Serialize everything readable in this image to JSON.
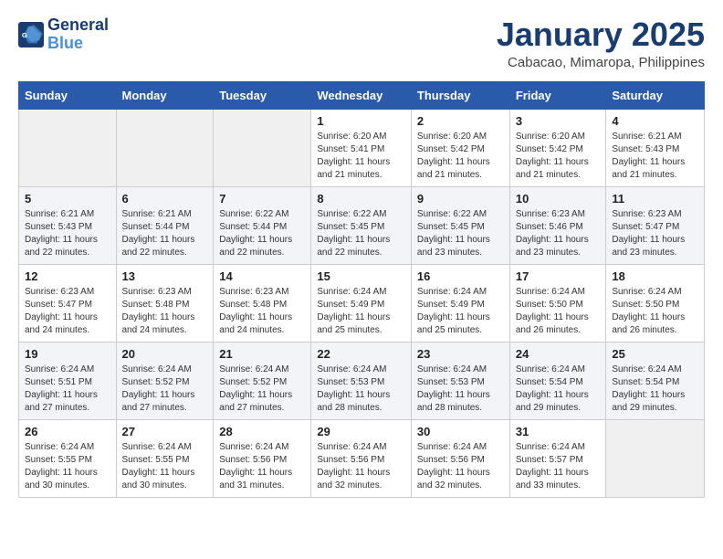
{
  "logo": {
    "text_general": "General",
    "text_blue": "Blue"
  },
  "calendar": {
    "title": "January 2025",
    "subtitle": "Cabacao, Mimaropa, Philippines"
  },
  "weekdays": [
    "Sunday",
    "Monday",
    "Tuesday",
    "Wednesday",
    "Thursday",
    "Friday",
    "Saturday"
  ],
  "weeks": [
    [
      {
        "day": "",
        "empty": true
      },
      {
        "day": "",
        "empty": true
      },
      {
        "day": "",
        "empty": true
      },
      {
        "day": "1",
        "sunrise": "6:20 AM",
        "sunset": "5:41 PM",
        "daylight": "11 hours and 21 minutes."
      },
      {
        "day": "2",
        "sunrise": "6:20 AM",
        "sunset": "5:42 PM",
        "daylight": "11 hours and 21 minutes."
      },
      {
        "day": "3",
        "sunrise": "6:20 AM",
        "sunset": "5:42 PM",
        "daylight": "11 hours and 21 minutes."
      },
      {
        "day": "4",
        "sunrise": "6:21 AM",
        "sunset": "5:43 PM",
        "daylight": "11 hours and 21 minutes."
      }
    ],
    [
      {
        "day": "5",
        "sunrise": "6:21 AM",
        "sunset": "5:43 PM",
        "daylight": "11 hours and 22 minutes."
      },
      {
        "day": "6",
        "sunrise": "6:21 AM",
        "sunset": "5:44 PM",
        "daylight": "11 hours and 22 minutes."
      },
      {
        "day": "7",
        "sunrise": "6:22 AM",
        "sunset": "5:44 PM",
        "daylight": "11 hours and 22 minutes."
      },
      {
        "day": "8",
        "sunrise": "6:22 AM",
        "sunset": "5:45 PM",
        "daylight": "11 hours and 22 minutes."
      },
      {
        "day": "9",
        "sunrise": "6:22 AM",
        "sunset": "5:45 PM",
        "daylight": "11 hours and 23 minutes."
      },
      {
        "day": "10",
        "sunrise": "6:23 AM",
        "sunset": "5:46 PM",
        "daylight": "11 hours and 23 minutes."
      },
      {
        "day": "11",
        "sunrise": "6:23 AM",
        "sunset": "5:47 PM",
        "daylight": "11 hours and 23 minutes."
      }
    ],
    [
      {
        "day": "12",
        "sunrise": "6:23 AM",
        "sunset": "5:47 PM",
        "daylight": "11 hours and 24 minutes."
      },
      {
        "day": "13",
        "sunrise": "6:23 AM",
        "sunset": "5:48 PM",
        "daylight": "11 hours and 24 minutes."
      },
      {
        "day": "14",
        "sunrise": "6:23 AM",
        "sunset": "5:48 PM",
        "daylight": "11 hours and 24 minutes."
      },
      {
        "day": "15",
        "sunrise": "6:24 AM",
        "sunset": "5:49 PM",
        "daylight": "11 hours and 25 minutes."
      },
      {
        "day": "16",
        "sunrise": "6:24 AM",
        "sunset": "5:49 PM",
        "daylight": "11 hours and 25 minutes."
      },
      {
        "day": "17",
        "sunrise": "6:24 AM",
        "sunset": "5:50 PM",
        "daylight": "11 hours and 26 minutes."
      },
      {
        "day": "18",
        "sunrise": "6:24 AM",
        "sunset": "5:50 PM",
        "daylight": "11 hours and 26 minutes."
      }
    ],
    [
      {
        "day": "19",
        "sunrise": "6:24 AM",
        "sunset": "5:51 PM",
        "daylight": "11 hours and 27 minutes."
      },
      {
        "day": "20",
        "sunrise": "6:24 AM",
        "sunset": "5:52 PM",
        "daylight": "11 hours and 27 minutes."
      },
      {
        "day": "21",
        "sunrise": "6:24 AM",
        "sunset": "5:52 PM",
        "daylight": "11 hours and 27 minutes."
      },
      {
        "day": "22",
        "sunrise": "6:24 AM",
        "sunset": "5:53 PM",
        "daylight": "11 hours and 28 minutes."
      },
      {
        "day": "23",
        "sunrise": "6:24 AM",
        "sunset": "5:53 PM",
        "daylight": "11 hours and 28 minutes."
      },
      {
        "day": "24",
        "sunrise": "6:24 AM",
        "sunset": "5:54 PM",
        "daylight": "11 hours and 29 minutes."
      },
      {
        "day": "25",
        "sunrise": "6:24 AM",
        "sunset": "5:54 PM",
        "daylight": "11 hours and 29 minutes."
      }
    ],
    [
      {
        "day": "26",
        "sunrise": "6:24 AM",
        "sunset": "5:55 PM",
        "daylight": "11 hours and 30 minutes."
      },
      {
        "day": "27",
        "sunrise": "6:24 AM",
        "sunset": "5:55 PM",
        "daylight": "11 hours and 30 minutes."
      },
      {
        "day": "28",
        "sunrise": "6:24 AM",
        "sunset": "5:56 PM",
        "daylight": "11 hours and 31 minutes."
      },
      {
        "day": "29",
        "sunrise": "6:24 AM",
        "sunset": "5:56 PM",
        "daylight": "11 hours and 32 minutes."
      },
      {
        "day": "30",
        "sunrise": "6:24 AM",
        "sunset": "5:56 PM",
        "daylight": "11 hours and 32 minutes."
      },
      {
        "day": "31",
        "sunrise": "6:24 AM",
        "sunset": "5:57 PM",
        "daylight": "11 hours and 33 minutes."
      },
      {
        "day": "",
        "empty": true
      }
    ]
  ]
}
